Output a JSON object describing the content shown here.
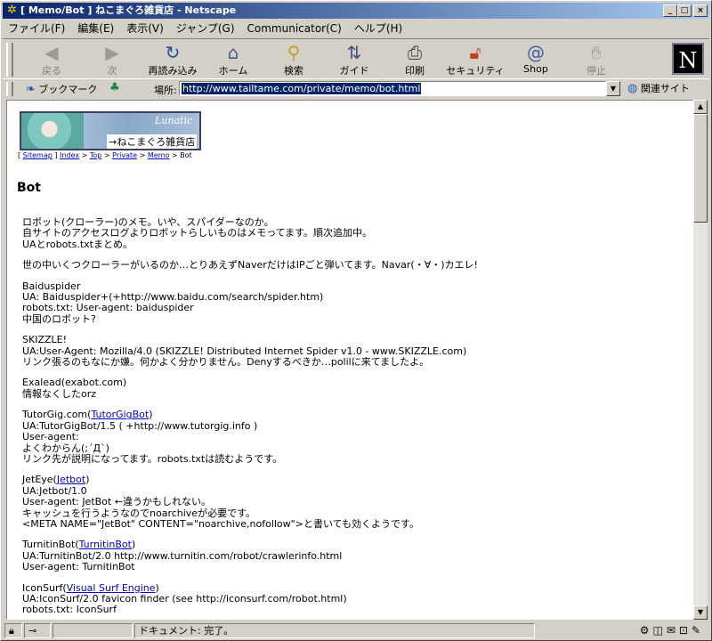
{
  "window": {
    "title": "[ Memo/Bot ] ねこまぐろ雑貨店 - Netscape"
  },
  "menu": [
    "ファイル(F)",
    "編集(E)",
    "表示(V)",
    "ジャンプ(G)",
    "Communicator(C)",
    "ヘルプ(H)"
  ],
  "toolbar": {
    "back": "戻る",
    "forward": "次",
    "reload": "再読み込み",
    "home": "ホーム",
    "search": "検索",
    "guide": "ガイド",
    "print": "印刷",
    "security": "セキュリティ",
    "shop": "Shop",
    "stop": "停止",
    "logo": "N"
  },
  "location": {
    "bookmarks": "ブックマーク",
    "label": "場所:",
    "url": "http://www.tailtame.com/private/memo/bot.html",
    "related": "関連サイト"
  },
  "page": {
    "banner_brand": "Lunatic",
    "banner_shop": "→ねこまぐろ雑貨店",
    "breadcrumb": {
      "open": "[",
      "sitemap": "Sitemap",
      "sep1": "]",
      "index": "Index",
      "top": "Top",
      "private": "Private",
      "memo": "Memo",
      "current": "Bot",
      "gt": ">"
    },
    "heading": "Bot",
    "intro1": "ロボット(クローラー)のメモ。いや、スパイダーなのか。",
    "intro2": "自サイトのアクセスログよりロボットらしいものはメモってます。順次追加中。",
    "intro3": "UAとrobots.txtまとめ。",
    "intro4": "世の中いくつクローラーがいるのか…とりあえずNaverだけはIPごと弾いてます。Navar(・∀・)カエレ!",
    "baidu_name": "Baiduspider",
    "baidu_ua": "UA: Baiduspider+(+http://www.baidu.com/search/spider.htm)",
    "baidu_robots": "robots.txt: User-agent: baiduspider",
    "baidu_note": "中国のロボット?",
    "skizzle_name": "SKIZZLE!",
    "skizzle_ua": "UA:User-Agent: Mozilla/4.0 (SKIZZLE! Distributed Internet Spider v1.0 - www.SKIZZLE.com)",
    "skizzle_note": "リンク張るのもなにか嫌。何かよく分かりません。Denyするべきか…polilに来てましたよ。",
    "exalead_name": "Exalead(exabot.com)",
    "exalead_note": "情報なくしたorz",
    "tutor_name": "TutorGig.com(",
    "tutor_link": "TutorGigBot",
    "tutor_close": ")",
    "tutor_ua": "UA:TutorGigBot/1.5 ( +http://www.tutorgig.info )",
    "tutor_robots": "User-agent:",
    "tutor_note1": "よくわからん(;´Д`)",
    "tutor_note2": "リンク先が説明になってます。robots.txtは読むようです。",
    "jeteye_name": "JetEye(",
    "jeteye_link": "Jetbot",
    "jeteye_close": ")",
    "jeteye_ua": "UA:Jetbot/1.0",
    "jeteye_robots": "User-agent: JetBot ←違うかもしれない。",
    "jeteye_note1": "キャッシュを行うようなのでnoarchiveが必要です。",
    "jeteye_note2": "<META NAME=\"JetBot\" CONTENT=\"noarchive,nofollow\">と書いても効くようです。",
    "turnitin_name": "TurnitinBot(",
    "turnitin_link": "TurnitinBot",
    "turnitin_close": ")",
    "turnitin_ua": "UA:TurnitinBot/2.0 http://www.turnitin.com/robot/crawlerinfo.html",
    "turnitin_robots": "User-agent: TurnitinBot",
    "iconsurf_name": "IconSurf(",
    "iconsurf_link": "Visual Surf Engine",
    "iconsurf_close": ")",
    "iconsurf_ua": "UA:IconSurf/2.0 favicon finder (see http://iconsurf.com/robot.html)",
    "iconsurf_robots": "robots.txt: IconSurf"
  },
  "status": {
    "text": "ドキュメント: 完了。"
  }
}
